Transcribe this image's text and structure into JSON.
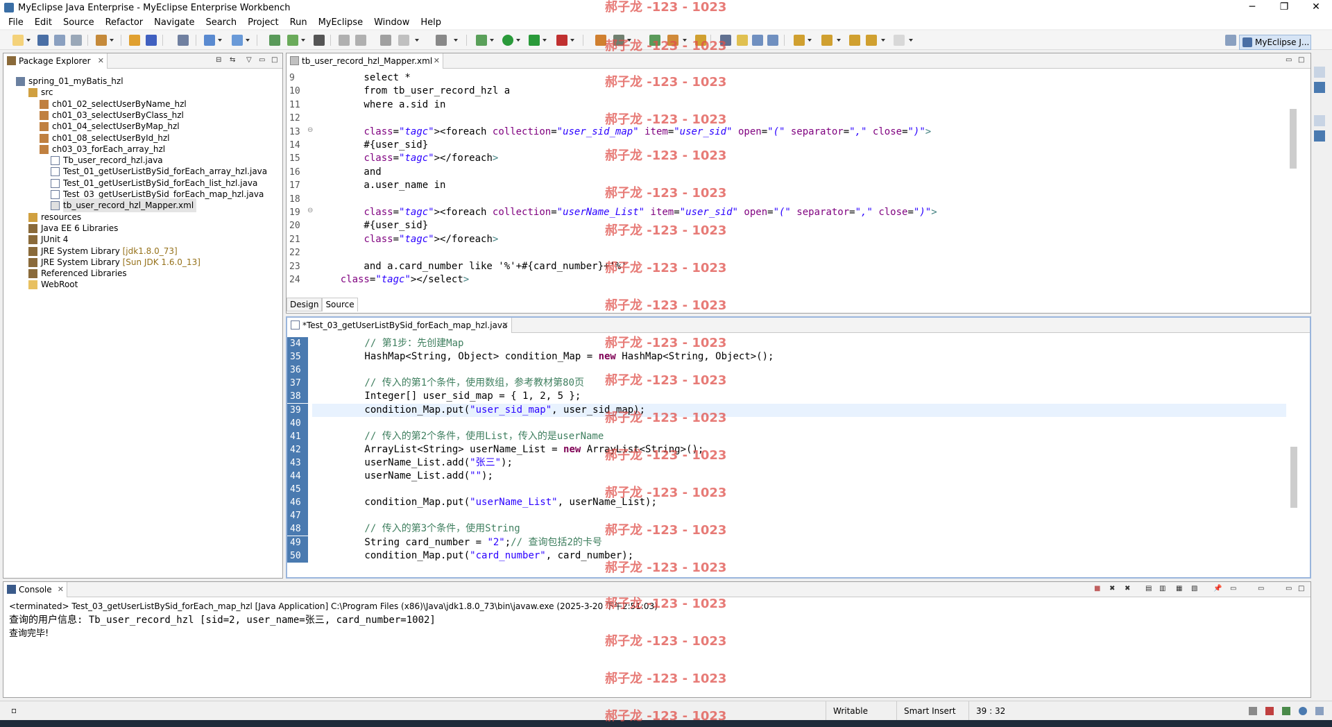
{
  "window": {
    "title": "MyEclipse Java Enterprise - MyEclipse Enterprise Workbench",
    "minimize": "─",
    "maximize": "❐",
    "close": "✕"
  },
  "menu": [
    "File",
    "Edit",
    "Source",
    "Refactor",
    "Navigate",
    "Search",
    "Project",
    "Run",
    "MyEclipse",
    "Window",
    "Help"
  ],
  "perspective": {
    "label": "MyEclipse J..."
  },
  "package_explorer": {
    "tab_label": "Package Explorer",
    "items": [
      {
        "label": "spring_01_myBatis_hzl",
        "icon": "project-icon"
      },
      {
        "label": "src",
        "icon": "source-folder-icon"
      },
      {
        "label": "ch01_02_selectUserByName_hzl",
        "icon": "package-icon"
      },
      {
        "label": "ch01_03_selectUserByClass_hzl",
        "icon": "package-icon"
      },
      {
        "label": "ch01_04_selectUserByMap_hzl",
        "icon": "package-icon"
      },
      {
        "label": "ch01_08_selectUserById_hzl",
        "icon": "package-icon"
      },
      {
        "label": "ch03_03_forEach_array_hzl",
        "icon": "package-icon"
      },
      {
        "label": "Tb_user_record_hzl.java",
        "icon": "java-file-icon"
      },
      {
        "label": "Test_01_getUserListBySid_forEach_array_hzl.java",
        "icon": "java-file-icon"
      },
      {
        "label": "Test_01_getUserListBySid_forEach_list_hzl.java",
        "icon": "java-file-icon"
      },
      {
        "label": "Test_03_getUserListBySid_forEach_map_hzl.java",
        "icon": "java-file-icon"
      },
      {
        "label": "tb_user_record_hzl_Mapper.xml",
        "icon": "xml-file-icon"
      },
      {
        "label": "resources",
        "icon": "source-folder-icon"
      },
      {
        "label": "Java EE 6 Libraries",
        "icon": "library-icon"
      },
      {
        "label": "JUnit 4",
        "icon": "library-icon"
      },
      {
        "label": "JRE System Library",
        "decoration": "[jdk1.8.0_73]",
        "icon": "library-icon"
      },
      {
        "label": "JRE System Library",
        "decoration": "[Sun JDK 1.6.0_13]",
        "icon": "library-icon"
      },
      {
        "label": "Referenced Libraries",
        "icon": "library-icon"
      },
      {
        "label": "WebRoot",
        "icon": "folder-icon"
      }
    ]
  },
  "xml_editor": {
    "tab_label": "tb_user_record_hzl_Mapper.xml",
    "line_numbers": [
      "9",
      "10",
      "11",
      "12",
      "13",
      "14",
      "15",
      "16",
      "17",
      "18",
      "19",
      "20",
      "21",
      "22",
      "23",
      "24"
    ],
    "lines": [
      "        select *",
      "        from tb_user_record_hzl a",
      "        where a.sid in",
      "",
      "        <foreach collection=\"user_sid_map\" item=\"user_sid\" open=\"(\" separator=\",\" close=\")\">",
      "        #{user_sid}",
      "        </foreach>",
      "        and",
      "        a.user_name in",
      "",
      "        <foreach collection=\"userName_List\" item=\"user_sid\" open=\"(\" separator=\",\" close=\")\">",
      "        #{user_sid}",
      "        </foreach>",
      "",
      "        and a.card_number like '%'+#{card_number}+'%'",
      "    </select>"
    ],
    "design_tab": "Design",
    "source_tab": "Source"
  },
  "java_editor": {
    "tab_label": "*Test_03_getUserListBySid_forEach_map_hzl.java",
    "line_numbers": [
      "34",
      "35",
      "36",
      "37",
      "38",
      "39",
      "40",
      "41",
      "42",
      "43",
      "44",
      "45",
      "46",
      "47",
      "48",
      "49",
      "50"
    ],
    "lines": [
      "        // 第1步：先创建Map",
      "        HashMap<String, Object> condition_Map = new HashMap<String, Object>();",
      "",
      "        // 传入的第1个条件，使用数组，参考教材第80页",
      "        Integer[] user_sid_map = { 1, 2, 5 };",
      "        condition_Map.put(\"user_sid_map\", user_sid_map);",
      "",
      "        // 传入的第2个条件，使用List，传入的是userName",
      "        ArrayList<String> userName_List = new ArrayList<String>();",
      "        userName_List.add(\"张三\");",
      "        userName_List.add(\"\");",
      "",
      "        condition_Map.put(\"userName_List\", userName_List);",
      "",
      "        // 传入的第3个条件，使用String",
      "        String card_number = \"2\";// 查询包括2的卡号",
      "        condition_Map.put(\"card_number\", card_number);"
    ]
  },
  "console": {
    "tab_label": "Console",
    "header": "<terminated> Test_03_getUserListBySid_forEach_map_hzl [Java Application] C:\\Program Files (x86)\\Java\\jdk1.8.0_73\\bin\\javaw.exe (2025-3-20 下午2:51:03)",
    "output": [
      "查询的用户信息: Tb_user_record_hzl [sid=2, user_name=张三, card_number=1002]",
      "查询完毕!"
    ]
  },
  "status": {
    "writable": "Writable",
    "insert_mode": "Smart Insert",
    "position": "39 : 32"
  },
  "watermark": "郝子龙 -123 - 1023",
  "colors": {
    "keyword": "#7f0055",
    "string": "#2a00ff",
    "comment": "#3f7f5f",
    "tag": "#3f7f7f",
    "attribute": "#7f007f",
    "watermark": "#e0504a"
  }
}
